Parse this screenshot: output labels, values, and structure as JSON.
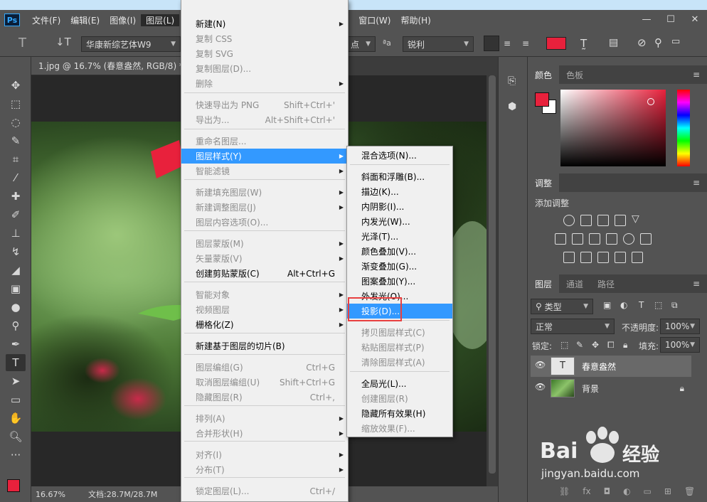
{
  "app": {
    "logo": "Ps"
  },
  "menubar": {
    "items": [
      "文件(F)",
      "编辑(E)",
      "图像(I)",
      "图层(L)",
      "窗口(W)",
      "帮助(H)"
    ],
    "window_min": "—",
    "window_max": "☐",
    "window_close": "✕"
  },
  "options": {
    "font_name": "华康新综艺体W9",
    "unit": "点",
    "aa_label": "ªa",
    "aa_value": "锐利",
    "text_color": "#e8213c"
  },
  "document": {
    "tab_title": "1.jpg @ 16.7% (春意盎然, RGB/8) *",
    "zoom": "16.67%",
    "doc_info": "文档:28.7M/28.7M"
  },
  "layer_menu": {
    "items": [
      {
        "label": "新建(N)",
        "shortcut": "",
        "sub": true,
        "disabled": false
      },
      {
        "label": "复制 CSS",
        "shortcut": "",
        "sub": false,
        "disabled": true
      },
      {
        "label": "复制 SVG",
        "shortcut": "",
        "sub": false,
        "disabled": true
      },
      {
        "label": "复制图层(D)...",
        "shortcut": "",
        "sub": false,
        "disabled": true
      },
      {
        "label": "删除",
        "shortcut": "",
        "sub": true,
        "disabled": true
      },
      {
        "label": "快速导出为 PNG",
        "shortcut": "Shift+Ctrl+'",
        "sub": false,
        "disabled": true
      },
      {
        "label": "导出为...",
        "shortcut": "Alt+Shift+Ctrl+'",
        "sub": false,
        "disabled": true
      },
      {
        "label": "重命名图层...",
        "shortcut": "",
        "sub": false,
        "disabled": true
      },
      {
        "label": "图层样式(Y)",
        "shortcut": "",
        "sub": true,
        "disabled": false,
        "highlight": true
      },
      {
        "label": "智能滤镜",
        "shortcut": "",
        "sub": true,
        "disabled": true
      },
      {
        "label": "新建填充图层(W)",
        "shortcut": "",
        "sub": true,
        "disabled": true
      },
      {
        "label": "新建调整图层(J)",
        "shortcut": "",
        "sub": true,
        "disabled": true
      },
      {
        "label": "图层内容选项(O)...",
        "shortcut": "",
        "sub": false,
        "disabled": true
      },
      {
        "label": "图层蒙版(M)",
        "shortcut": "",
        "sub": true,
        "disabled": true
      },
      {
        "label": "矢量蒙版(V)",
        "shortcut": "",
        "sub": true,
        "disabled": true
      },
      {
        "label": "创建剪贴蒙版(C)",
        "shortcut": "Alt+Ctrl+G",
        "sub": false,
        "disabled": false
      },
      {
        "label": "智能对象",
        "shortcut": "",
        "sub": true,
        "disabled": true
      },
      {
        "label": "视频图层",
        "shortcut": "",
        "sub": true,
        "disabled": true
      },
      {
        "label": "栅格化(Z)",
        "shortcut": "",
        "sub": true,
        "disabled": false
      },
      {
        "label": "新建基于图层的切片(B)",
        "shortcut": "",
        "sub": false,
        "disabled": false
      },
      {
        "label": "图层编组(G)",
        "shortcut": "Ctrl+G",
        "sub": false,
        "disabled": true
      },
      {
        "label": "取消图层编组(U)",
        "shortcut": "Shift+Ctrl+G",
        "sub": false,
        "disabled": true
      },
      {
        "label": "隐藏图层(R)",
        "shortcut": "Ctrl+,",
        "sub": false,
        "disabled": true
      },
      {
        "label": "排列(A)",
        "shortcut": "",
        "sub": true,
        "disabled": true
      },
      {
        "label": "合并形状(H)",
        "shortcut": "",
        "sub": true,
        "disabled": true
      },
      {
        "label": "对齐(I)",
        "shortcut": "",
        "sub": true,
        "disabled": true
      },
      {
        "label": "分布(T)",
        "shortcut": "",
        "sub": true,
        "disabled": true
      },
      {
        "label": "锁定图层(L)...",
        "shortcut": "Ctrl+/",
        "sub": false,
        "disabled": true
      }
    ]
  },
  "style_menu": {
    "items": [
      {
        "label": "混合选项(N)...",
        "disabled": false
      },
      {
        "label": "斜面和浮雕(B)...",
        "disabled": false
      },
      {
        "label": "描边(K)...",
        "disabled": false
      },
      {
        "label": "内阴影(I)...",
        "disabled": false
      },
      {
        "label": "内发光(W)...",
        "disabled": false
      },
      {
        "label": "光泽(T)...",
        "disabled": false
      },
      {
        "label": "颜色叠加(V)...",
        "disabled": false
      },
      {
        "label": "渐变叠加(G)...",
        "disabled": false
      },
      {
        "label": "图案叠加(Y)...",
        "disabled": false
      },
      {
        "label": "外发光(O)...",
        "disabled": false
      },
      {
        "label": "投影(D)...",
        "disabled": false,
        "highlight": true
      },
      {
        "label": "拷贝图层样式(C)",
        "disabled": true
      },
      {
        "label": "粘贴图层样式(P)",
        "disabled": true
      },
      {
        "label": "清除图层样式(A)",
        "disabled": true
      },
      {
        "label": "全局光(L)...",
        "disabled": false
      },
      {
        "label": "创建图层(R)",
        "disabled": true
      },
      {
        "label": "隐藏所有效果(H)",
        "disabled": false
      },
      {
        "label": "缩放效果(F)...",
        "disabled": true
      }
    ]
  },
  "color_panel": {
    "tabs": [
      "颜色",
      "色板"
    ],
    "fg": "#e8213c"
  },
  "adjust_panel": {
    "tab": "调整",
    "add_label": "添加调整"
  },
  "layers_panel": {
    "tabs": [
      "图层",
      "通道",
      "路径"
    ],
    "filter_label": "类型",
    "blend_mode": "正常",
    "opacity_label": "不透明度:",
    "opacity_value": "100%",
    "lock_label": "锁定:",
    "fill_label": "填充:",
    "fill_value": "100%",
    "layers": [
      {
        "name": "春意盎然",
        "type": "text"
      },
      {
        "name": "背景",
        "type": "image"
      }
    ]
  },
  "watermark": {
    "brand": "Bai",
    "brand2": "经验",
    "url": "jingyan.baidu.com"
  }
}
